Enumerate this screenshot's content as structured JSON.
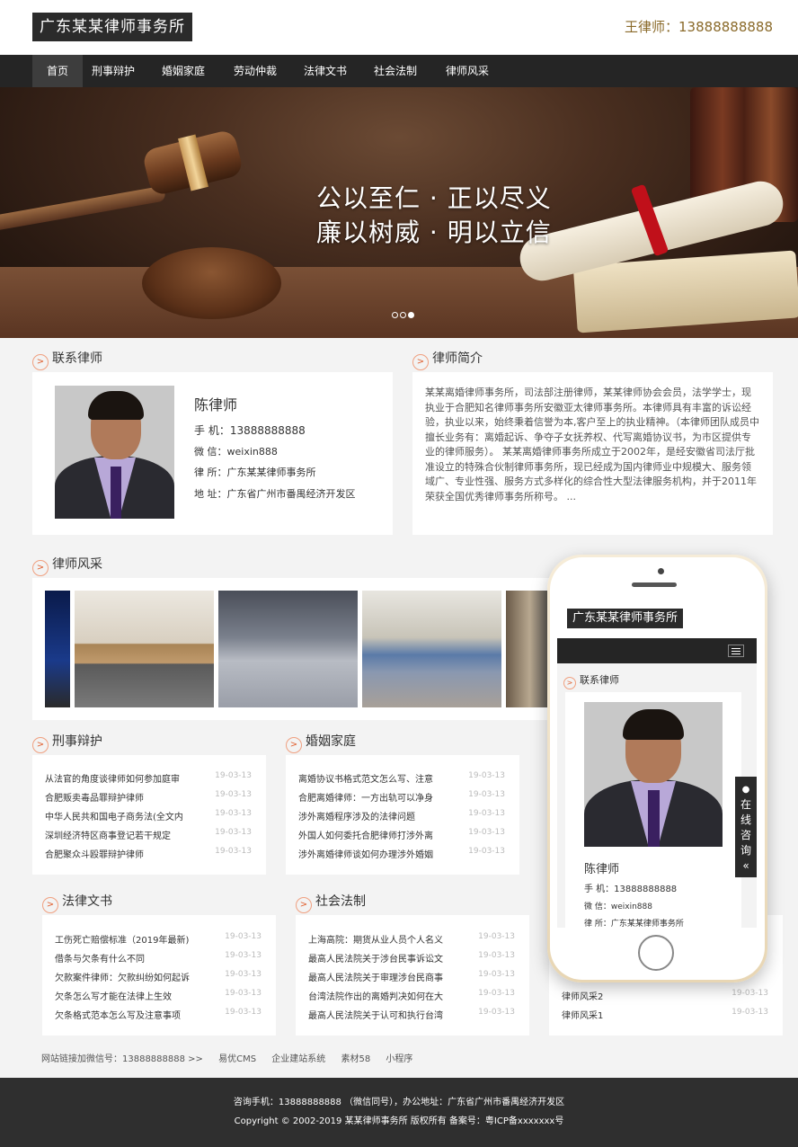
{
  "header": {
    "logo": "广东某某律师事务所",
    "phone_label": "王律师：13888888888"
  },
  "nav": {
    "items": [
      {
        "label": "首页",
        "active": true
      },
      {
        "label": "刑事辩护"
      },
      {
        "label": "婚姻家庭"
      },
      {
        "label": "劳动仲裁"
      },
      {
        "label": "法律文书"
      },
      {
        "label": "社会法制"
      },
      {
        "label": "律师风采"
      }
    ]
  },
  "banner": {
    "line1": "公以至仁 · 正以尽义",
    "line2": "廉以树威 · 明以立信",
    "active_slide": 2
  },
  "contact": {
    "title": "联系律师",
    "name": "陈律师",
    "mobile": "手  机：13888888888",
    "wechat": "微  信：weixin888",
    "firm": "律  所：广东某某律师事务所",
    "address": "地  址：广东省广州市番禺经济开发区"
  },
  "intro": {
    "title": "律师简介",
    "text": "某某离婚律师事务所，司法部注册律师，某某律师协会会员，法学学士，现执业于合肥知名律师事务所安徽亚太律师事务所。本律师具有丰富的诉讼经验，执业以来，始终秉着信誉为本,客户至上的执业精神。（本律师团队成员中擅长业务有：离婚起诉、争夺子女抚养权、代写离婚协议书，为市区提供专业的律师服务）。 某某离婚律师事务所成立于2002年，是经安徽省司法厅批准设立的特殊合伙制律师事务所，现已经成为国内律师业中规模大、服务领域广、专业性强、服务方式多样化的综合性大型法律服务机构，并于2011年荣获全国优秀律师事务所称号。 ..."
  },
  "gallery": {
    "title": "律师风采"
  },
  "criminal": {
    "title": "刑事辩护",
    "items": [
      {
        "t": "从法官的角度谈律师如何参加庭审",
        "d": "19-03-13"
      },
      {
        "t": "合肥贩卖毒品罪辩护律师",
        "d": "19-03-13"
      },
      {
        "t": "中华人民共和国电子商务法(全文内",
        "d": "19-03-13"
      },
      {
        "t": "深圳经济特区商事登记若干规定",
        "d": "19-03-13"
      },
      {
        "t": "合肥聚众斗殴罪辩护律师",
        "d": "19-03-13"
      }
    ]
  },
  "marriage": {
    "title": "婚姻家庭",
    "items": [
      {
        "t": "离婚协议书格式范文怎么写、注意",
        "d": "19-03-13"
      },
      {
        "t": "合肥离婚律师：一方出轨可以净身",
        "d": "19-03-13"
      },
      {
        "t": "涉外离婚程序涉及的法律问题",
        "d": "19-03-13"
      },
      {
        "t": "外国人如何委托合肥律师打涉外离",
        "d": "19-03-13"
      },
      {
        "t": "涉外离婚律师谈如何办理涉外婚姻",
        "d": "19-03-13"
      }
    ]
  },
  "documents": {
    "title": "法律文书",
    "items": [
      {
        "t": "工伤死亡赔偿标准（2019年最新)",
        "d": "19-03-13"
      },
      {
        "t": "借条与欠条有什么不同",
        "d": "19-03-13"
      },
      {
        "t": "欠款案件律师：欠款纠纷如何起诉",
        "d": "19-03-13"
      },
      {
        "t": "欠条怎么写才能在法律上生效",
        "d": "19-03-13"
      },
      {
        "t": "欠条格式范本怎么写及注意事项",
        "d": "19-03-13"
      }
    ]
  },
  "social": {
    "title": "社会法制",
    "items": [
      {
        "t": "上海高院：期货从业人员个人名义",
        "d": "19-03-13"
      },
      {
        "t": "最高人民法院关于涉台民事诉讼文",
        "d": "19-03-13"
      },
      {
        "t": "最高人民法院关于审理涉台民商事",
        "d": "19-03-13"
      },
      {
        "t": "台湾法院作出的离婚判决如何在大",
        "d": "19-03-13"
      },
      {
        "t": "最高人民法院关于认可和执行台湾",
        "d": "19-03-13"
      }
    ]
  },
  "style_list": {
    "items": [
      {
        "t": "律师风采2",
        "d": "19-03-13"
      },
      {
        "t": "律师风采1",
        "d": "19-03-13"
      }
    ]
  },
  "friend_links": {
    "label": "网站链接加微信号：13888888888 >>",
    "items": [
      "易优CMS",
      "企业建站系统",
      "素材58",
      "小程序"
    ]
  },
  "footer": {
    "line1": "咨询手机：13888888888 （微信同号），办公地址：广东省广州市番禺经济开发区",
    "line2": "Copyright © 2002-2019 某某律师事务所 版权所有 备案号：粤ICP备xxxxxxx号"
  },
  "mobile_preview": {
    "logo": "广东某某律师事务所",
    "section_title": "联系律师",
    "name": "陈律师",
    "mobile": "手  机：13888888888",
    "wechat": "微  信：weixin888",
    "firm": "律  所：广东某某律师事务所"
  },
  "float_consult": {
    "label": "在线咨询",
    "collapse": "«"
  }
}
